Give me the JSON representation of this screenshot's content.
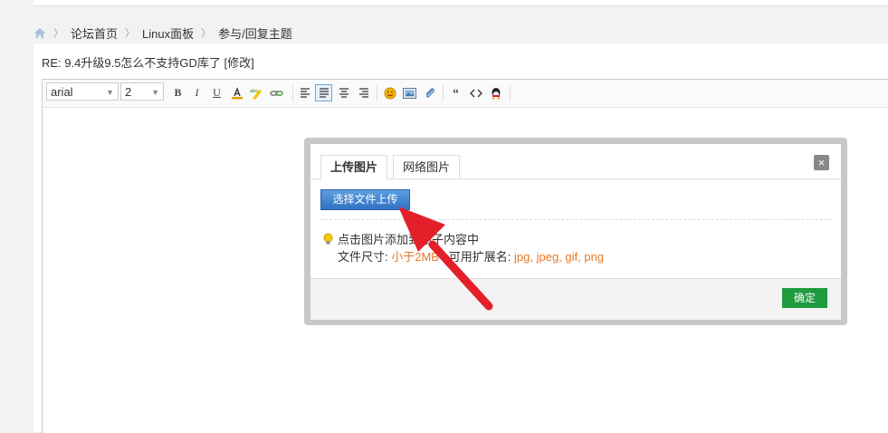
{
  "breadcrumb": {
    "home_icon": "home-icon",
    "items": [
      "论坛首页",
      "Linux面板",
      "参与/回复主题"
    ]
  },
  "post": {
    "title": "RE: 9.4升级9.5怎么不支持GD库了 [修改]"
  },
  "toolbar": {
    "font_family": "arial",
    "font_size": "2"
  },
  "dialog": {
    "tabs": [
      "上传图片",
      "网络图片"
    ],
    "close_label": "×",
    "upload_button": "选择文件上传",
    "tip_line1": "点击图片添加到帖子内容中",
    "tip_size_label": "文件尺寸: ",
    "tip_size_value": "小于2MB",
    "tip_ext_label": " , 可用扩展名: ",
    "tip_ext_value": "jpg, jpeg, gif, png",
    "confirm_button": "确定"
  },
  "colors": {
    "accent_blue": "#2f72c4",
    "confirm_green": "#1e9b3d",
    "highlight_orange": "#e67a28",
    "arrow_red": "#e3202a"
  }
}
